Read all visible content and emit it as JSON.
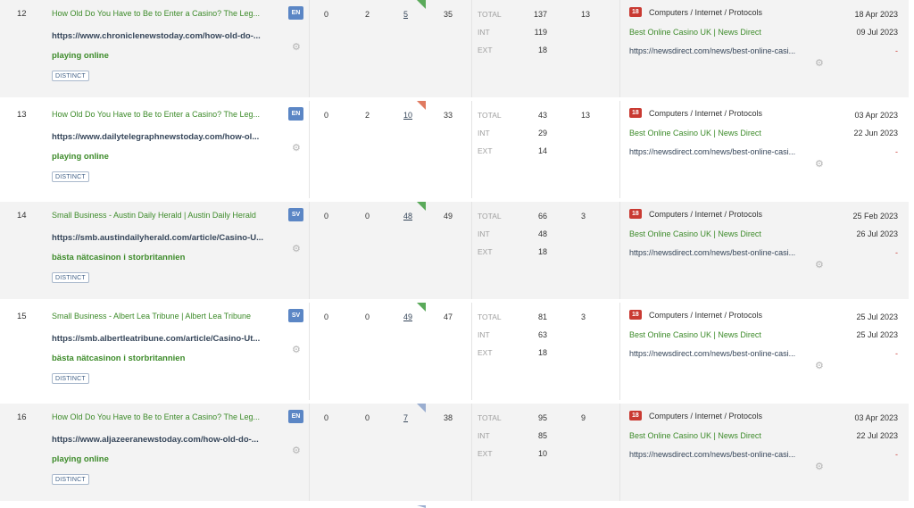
{
  "rows": [
    {
      "num": "12",
      "title": "How Old Do You Have to Be to Enter a Casino? The Leg...",
      "url": "https://www.chroniclenewstoday.com/how-old-do-...",
      "anchor": "playing online",
      "tag": "DISTINCT",
      "lang": "EN",
      "c1": "0",
      "c2": "2",
      "c3": "5",
      "c4": "35",
      "corner": "green",
      "total_label": "TOTAL",
      "int_label": "INT",
      "ext_label": "EXT",
      "total": "137",
      "int": "119",
      "ext": "18",
      "rd": "13",
      "cat_badge": "18",
      "category": "Computers / Internet / Protocols",
      "target_title": "Best Online Casino UK | News Direct",
      "target_url": "https://newsdirect.com/news/best-online-casi...",
      "date1": "18 Apr 2023",
      "date2": "09 Jul 2023",
      "date3": "-"
    },
    {
      "num": "13",
      "title": "How Old Do You Have to Be to Enter a Casino? The Leg...",
      "url": "https://www.dailytelegraphnewstoday.com/how-ol...",
      "anchor": "playing online",
      "tag": "DISTINCT",
      "lang": "EN",
      "c1": "0",
      "c2": "2",
      "c3": "10",
      "c4": "33",
      "corner": "red",
      "total_label": "TOTAL",
      "int_label": "INT",
      "ext_label": "EXT",
      "total": "43",
      "int": "29",
      "ext": "14",
      "rd": "13",
      "cat_badge": "18",
      "category": "Computers / Internet / Protocols",
      "target_title": "Best Online Casino UK | News Direct",
      "target_url": "https://newsdirect.com/news/best-online-casi...",
      "date1": "03 Apr 2023",
      "date2": "22 Jun 2023",
      "date3": "-"
    },
    {
      "num": "14",
      "title": "Small Business - Austin Daily Herald | Austin Daily Herald",
      "url": "https://smb.austindailyherald.com/article/Casino-U...",
      "anchor": "bästa nätcasinon i storbritannien",
      "tag": "DISTINCT",
      "lang": "SV",
      "c1": "0",
      "c2": "0",
      "c3": "48",
      "c4": "49",
      "corner": "green",
      "total_label": "TOTAL",
      "int_label": "INT",
      "ext_label": "EXT",
      "total": "66",
      "int": "48",
      "ext": "18",
      "rd": "3",
      "cat_badge": "18",
      "category": "Computers / Internet / Protocols",
      "target_title": "Best Online Casino UK | News Direct",
      "target_url": "https://newsdirect.com/news/best-online-casi...",
      "date1": "25 Feb 2023",
      "date2": "26 Jul 2023",
      "date3": "-"
    },
    {
      "num": "15",
      "title": "Small Business - Albert Lea Tribune | Albert Lea Tribune",
      "url": "https://smb.albertleatribune.com/article/Casino-Ut...",
      "anchor": "bästa nätcasinon i storbritannien",
      "tag": "DISTINCT",
      "lang": "SV",
      "c1": "0",
      "c2": "0",
      "c3": "49",
      "c4": "47",
      "corner": "green",
      "total_label": "TOTAL",
      "int_label": "INT",
      "ext_label": "EXT",
      "total": "81",
      "int": "63",
      "ext": "18",
      "rd": "3",
      "cat_badge": "18",
      "category": "Computers / Internet / Protocols",
      "target_title": "Best Online Casino UK | News Direct",
      "target_url": "https://newsdirect.com/news/best-online-casi...",
      "date1": "25 Jul 2023",
      "date2": "25 Jul 2023",
      "date3": "-"
    },
    {
      "num": "16",
      "title": "How Old Do You Have to Be to Enter a Casino? The Leg...",
      "url": "https://www.aljazeeranewstoday.com/how-old-do-...",
      "anchor": "playing online",
      "tag": "DISTINCT",
      "lang": "EN",
      "c1": "0",
      "c2": "0",
      "c3": "7",
      "c4": "38",
      "corner": "blue",
      "total_label": "TOTAL",
      "int_label": "INT",
      "ext_label": "EXT",
      "total": "95",
      "int": "85",
      "ext": "10",
      "rd": "9",
      "cat_badge": "18",
      "category": "Computers / Internet / Protocols",
      "target_title": "Best Online Casino UK | News Direct",
      "target_url": "https://newsdirect.com/news/best-online-casi...",
      "date1": "03 Apr 2023",
      "date2": "22 Jul 2023",
      "date3": "-"
    }
  ],
  "icons": {
    "settings": "gear-icon"
  },
  "colors": {
    "link_green": "#3d8b2a",
    "url_navy": "#36465a",
    "category_badge": "#c93a32",
    "lang_badge": "#5b86c5",
    "marker_green": "#5aaa5a",
    "marker_red": "#e07a60",
    "marker_blue": "#9aaed0"
  }
}
